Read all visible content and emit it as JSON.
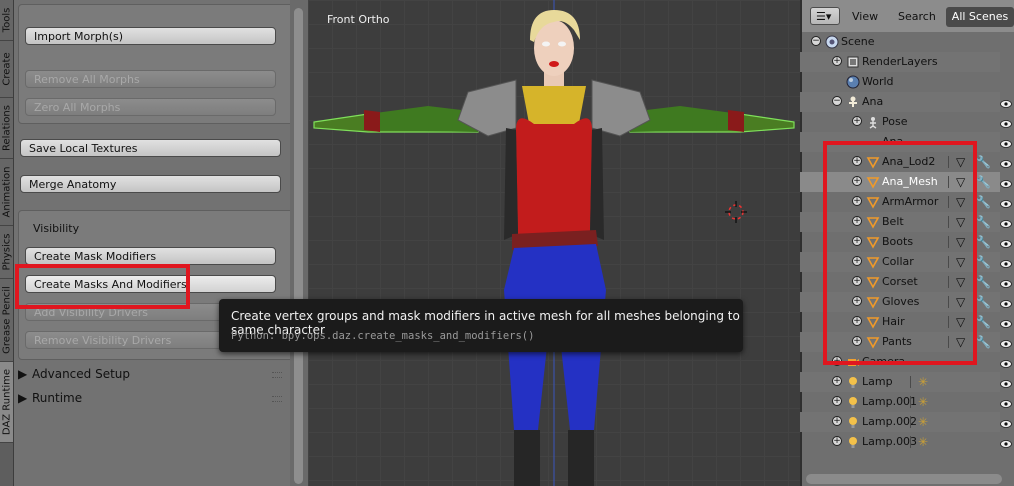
{
  "vertical_tabs": [
    "Tools",
    "Create",
    "Relations",
    "Animation",
    "Physics",
    "Grease Pencil",
    "DAZ Runtime"
  ],
  "tool_panel": {
    "import_morphs": "Import Morph(s)",
    "remove_all_morphs": "Remove All Morphs",
    "zero_all_morphs": "Zero All Morphs",
    "save_local_textures": "Save Local Textures",
    "merge_anatomy": "Merge Anatomy",
    "visibility_label": "Visibility",
    "create_mask_modifiers": "Create Mask Modifiers",
    "create_masks_and_modifiers": "Create Masks And Modifiers",
    "add_visibility_drivers": "Add Visibility Drivers",
    "remove_visibility_drivers": "Remove Visibility Drivers",
    "advanced_setup": "Advanced Setup",
    "runtime": "Runtime"
  },
  "viewport": {
    "label": "Front Ortho"
  },
  "tooltip": {
    "description": "Create vertex groups and mask modifiers in active mesh for all meshes belonging to same character",
    "python": "Python: bpy.ops.daz.create_masks_and_modifiers()"
  },
  "outliner": {
    "header": {
      "view": "View",
      "search": "Search",
      "scenes": "All Scenes"
    },
    "rows": [
      {
        "label": "Scene",
        "icon": "scene-icon"
      },
      {
        "label": "RenderLayers",
        "icon": "render-layers-icon"
      },
      {
        "label": "World",
        "icon": "world-icon"
      },
      {
        "label": "Ana",
        "icon": "armature-icon"
      },
      {
        "label": "Pose",
        "icon": "pose-icon"
      },
      {
        "label": "Ana",
        "icon": "armature-data-icon"
      },
      {
        "label": "Ana_Lod2",
        "icon": "mesh-icon"
      },
      {
        "label": "Ana_Mesh",
        "icon": "mesh-icon"
      },
      {
        "label": "ArmArmor",
        "icon": "mesh-icon"
      },
      {
        "label": "Belt",
        "icon": "mesh-icon"
      },
      {
        "label": "Boots",
        "icon": "mesh-icon"
      },
      {
        "label": "Collar",
        "icon": "mesh-icon"
      },
      {
        "label": "Corset",
        "icon": "mesh-icon"
      },
      {
        "label": "Gloves",
        "icon": "mesh-icon"
      },
      {
        "label": "Hair",
        "icon": "mesh-icon"
      },
      {
        "label": "Pants",
        "icon": "mesh-icon"
      },
      {
        "label": "Camera",
        "icon": "camera-icon"
      },
      {
        "label": "Lamp",
        "icon": "lamp-icon"
      },
      {
        "label": "Lamp.001",
        "icon": "lamp-icon"
      },
      {
        "label": "Lamp.002",
        "icon": "lamp-icon"
      },
      {
        "label": "Lamp.003",
        "icon": "lamp-icon"
      }
    ]
  },
  "colors": {
    "highlight": "#e0161f",
    "selected_object": "#ffffff"
  }
}
